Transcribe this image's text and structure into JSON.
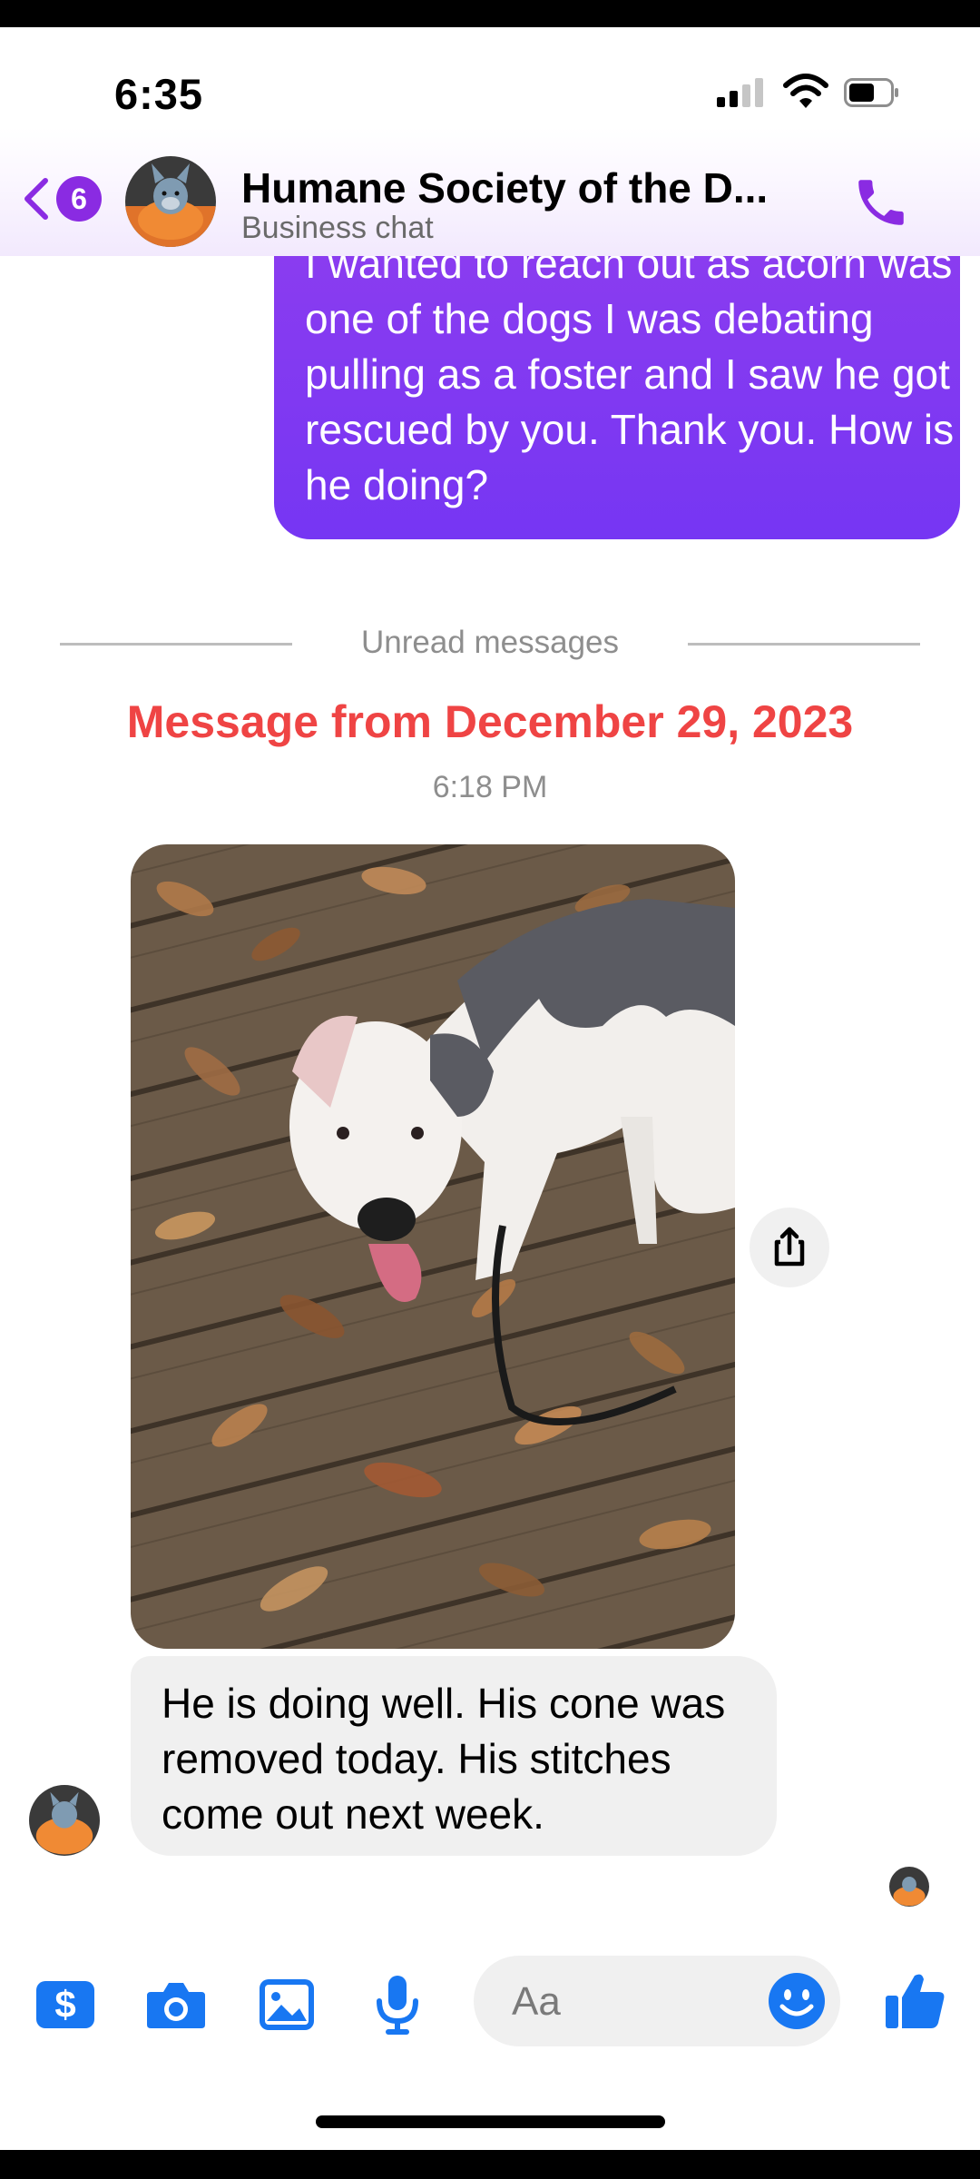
{
  "status_bar": {
    "time": "6:35"
  },
  "header": {
    "back_badge_count": "6",
    "title": "Humane Society of the D...",
    "subtitle": "Business chat",
    "icons": {
      "back": "chevron-left-icon",
      "call": "phone-icon"
    }
  },
  "messages": {
    "outgoing_text": "I wanted to reach out as acorn was one of the dogs I was debating pulling as a foster and I saw he got rescued by you. Thank you. How is he doing?",
    "unread_label": "Unread messages",
    "date_header": "Message from December 29, 2023",
    "time": "6:18 PM",
    "incoming_text": "He is doing well. His cone was removed today. His stitches come out next week."
  },
  "composer": {
    "placeholder": "Aa",
    "tools": [
      "dollar-icon",
      "camera-icon",
      "image-icon",
      "microphone-icon"
    ],
    "emoji_icon": "smiley-icon",
    "like_icon": "thumbs-up-icon"
  },
  "colors": {
    "accent": "#8a2be2",
    "outgoing_bubble": "#7a38f2",
    "incoming_bubble": "#f0f0f0",
    "date_header": "#ef4444",
    "composer_icons": "#1877f2"
  }
}
